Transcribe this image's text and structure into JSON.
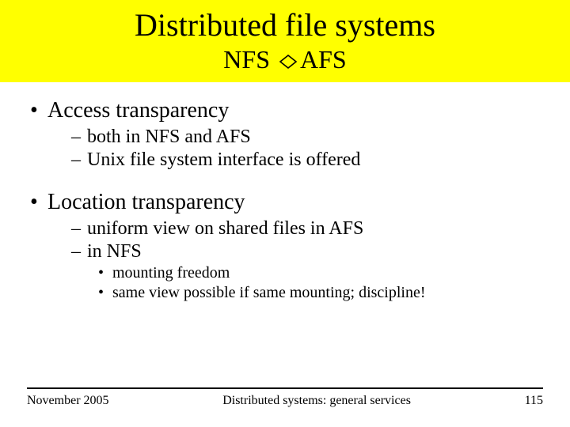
{
  "title": "Distributed file systems",
  "subtitle_left": "NFS ",
  "subtitle_right": "AFS",
  "bullets": {
    "a": {
      "label": "Access transparency",
      "sub": [
        "both in NFS and AFS",
        "Unix file system interface is offered"
      ]
    },
    "b": {
      "label": "Location transparency",
      "sub": [
        "uniform view on shared files in AFS",
        "in NFS"
      ],
      "subsub": [
        "mounting freedom",
        "same view possible if same mounting; discipline!"
      ]
    }
  },
  "footer": {
    "left": "November 2005",
    "center": "Distributed systems: general services",
    "right": "115"
  }
}
